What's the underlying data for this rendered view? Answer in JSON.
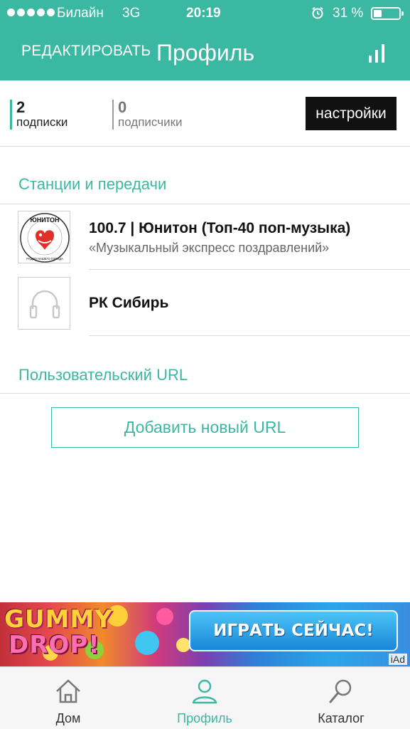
{
  "status_bar": {
    "carrier": "Билайн",
    "network": "3G",
    "time": "20:19",
    "battery_percent": "31 %",
    "signal_dots": 5,
    "icons": [
      "signal-dots-icon",
      "alarm-icon",
      "battery-icon"
    ]
  },
  "nav": {
    "edit_label": "РЕДАКТИРОВАТЬ",
    "title": "Профиль",
    "right_icon": "equalizer-icon"
  },
  "stats": {
    "subscriptions_count": "2",
    "subscriptions_label": "подписки",
    "followers_count": "0",
    "followers_label": "подписчики",
    "settings_label": "настройки"
  },
  "stations_section": {
    "title": "Станции и передачи",
    "items": [
      {
        "title": "100.7 | Юнитон (Топ-40 поп-музыка)",
        "subtitle": "«Музыкальный экспресс поздравлений»",
        "thumb": "uniton-logo",
        "logo_text": "ЮНИТОН",
        "logo_ring_text": "РАДИО НАШЕГО ГОРОДА"
      },
      {
        "title": "РК Сибирь",
        "subtitle": "",
        "thumb": "headphones-icon"
      }
    ]
  },
  "custom_url_section": {
    "title": "Пользовательский URL",
    "add_button_label": "Добавить новый URL"
  },
  "ad": {
    "logo_line1": "GUMMY",
    "logo_line2": "DROP!",
    "cta_label": "ИГРАТЬ СЕЙЧАС!",
    "badge": "iAd"
  },
  "tabbar": {
    "items": [
      {
        "label": "Дом",
        "icon": "home-icon",
        "active": false
      },
      {
        "label": "Профиль",
        "icon": "profile-icon",
        "active": true
      },
      {
        "label": "Каталог",
        "icon": "search-icon",
        "active": false
      }
    ]
  },
  "colors": {
    "accent": "#3bb8a2",
    "settings_button_bg": "#111111",
    "tab_inactive": "#555555"
  }
}
